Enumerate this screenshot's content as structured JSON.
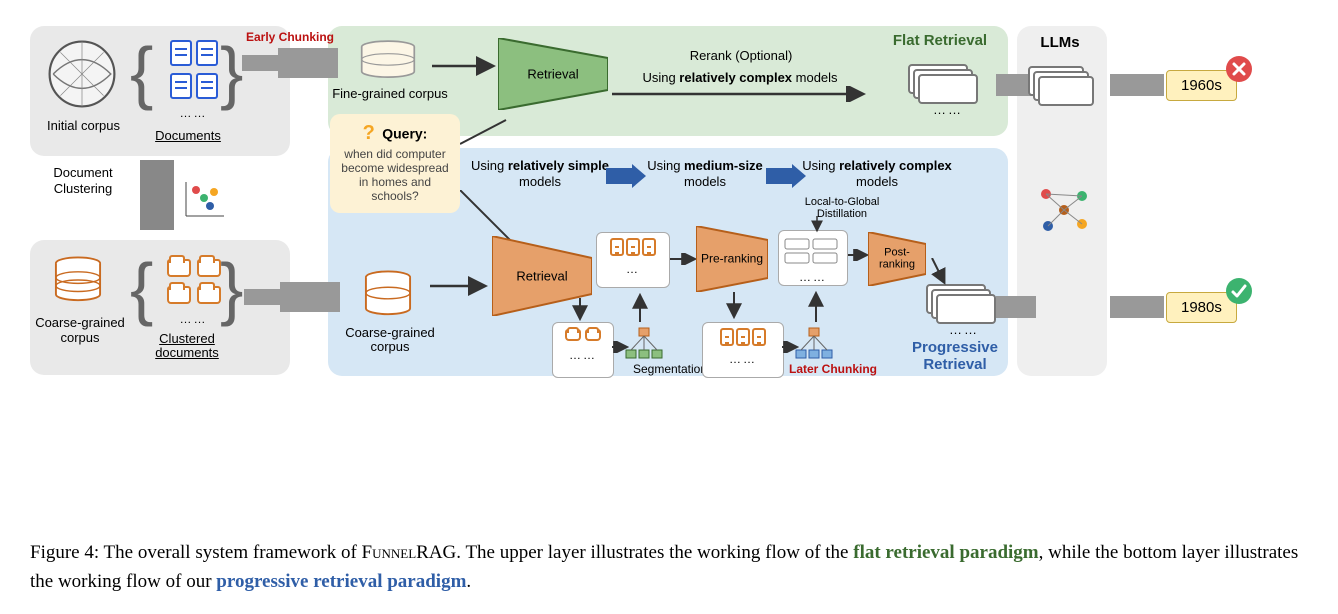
{
  "caption": {
    "prefix": "Figure 4: The overall system framework of ",
    "name": "FunnelRAG",
    "mid": ". The upper layer illustrates the working flow of the ",
    "flat": "flat retrieval paradigm",
    "mid2": ", while the bottom layer illustrates the working flow of our ",
    "prog": "progressive retrieval paradigm",
    "end": "."
  },
  "left": {
    "initial_corpus": "Initial corpus",
    "documents": "Documents",
    "doc_clustering": "Document Clustering",
    "coarse_corpus": "Coarse-grained corpus",
    "clustered_docs": "Clustered documents"
  },
  "query": {
    "label": "Query:",
    "text": "when did computer become widespread in homes and schools?"
  },
  "flat": {
    "early_chunking": "Early Chunking",
    "fine_corpus": "Fine-grained corpus",
    "retrieval": "Retrieval",
    "rerank": "Rerank (Optional)",
    "using_complex": "Using relatively complex models",
    "title": "Flat Retrieval"
  },
  "prog": {
    "coarse_corpus2": "Coarse-grained corpus",
    "retrieval": "Retrieval",
    "preranking": "Pre-ranking",
    "postranking": "Post-ranking",
    "segmentation": "Segmentation",
    "later_chunking": "Later Chunking",
    "title": "Progressive Retrieval",
    "l2g": "Local-to-Global Distillation",
    "simple_pre": "Using ",
    "simple_bold": "relatively simple",
    "simple_post": " models",
    "medium_pre": "Using ",
    "medium_bold": "medium-size",
    "medium_post": " models",
    "complex_pre": "Using ",
    "complex_bold": "relatively complex",
    "complex_post": " models"
  },
  "right": {
    "llms": "LLMs",
    "out_wrong": "1960s",
    "out_right": "1980s"
  }
}
